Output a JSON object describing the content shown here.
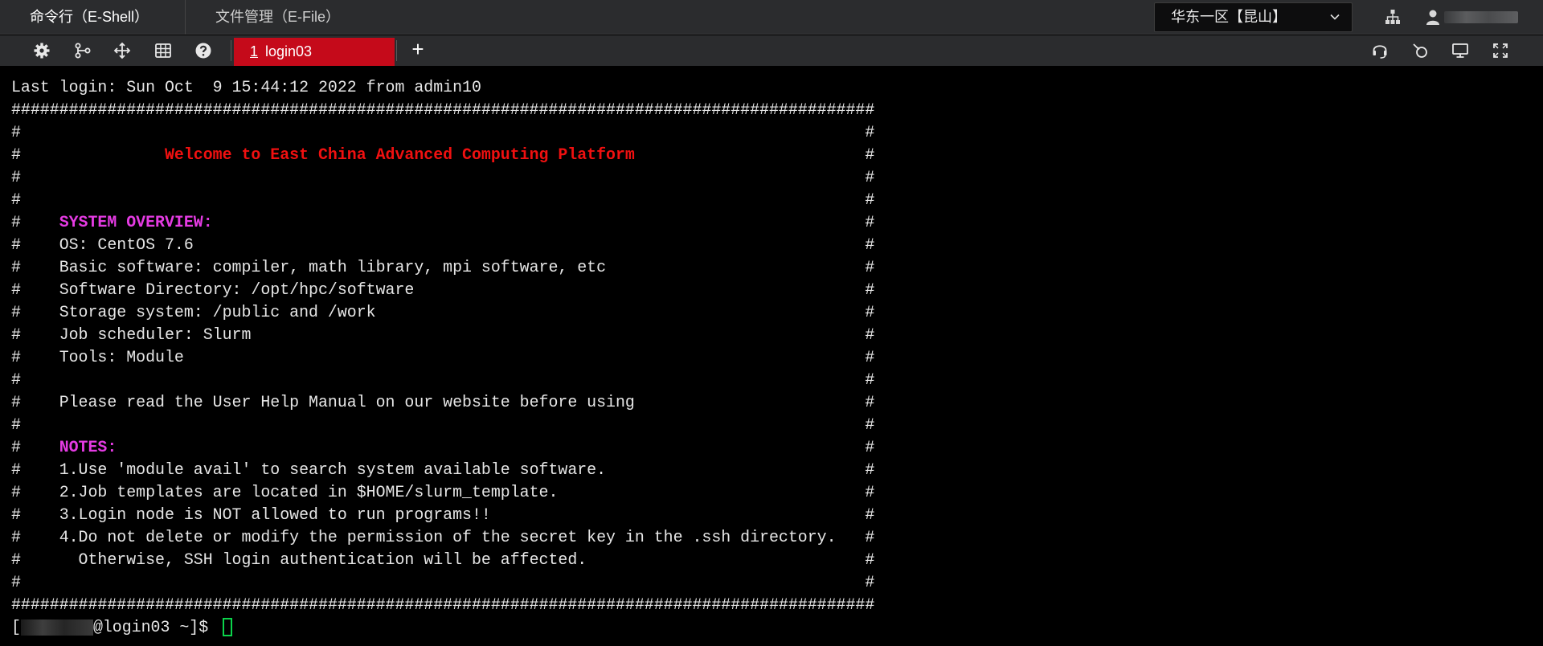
{
  "header": {
    "tabs": [
      {
        "label": "命令行（E-Shell）"
      },
      {
        "label": "文件管理（E-File）"
      }
    ],
    "region": "华东一区【昆山】"
  },
  "toolbar": {
    "session_tab": {
      "num": "1",
      "label": " login03"
    },
    "add_label": "+"
  },
  "terminal": {
    "last_login": "Last login: Sun Oct  9 15:44:12 2022 from admin10",
    "border": "##########################################################################################",
    "welcome": "Welcome to East China Advanced Computing Platform",
    "overview_heading": "SYSTEM OVERVIEW:",
    "overview_lines": [
      "OS: CentOS 7.6",
      "Basic software: compiler, math library, mpi software, etc",
      "Software Directory: /opt/hpc/software",
      "Storage system: /public and /work",
      "Job scheduler: Slurm",
      "Tools: Module"
    ],
    "help_line": "Please read the User Help Manual on our website before using",
    "notes_heading": "NOTES:",
    "notes": [
      "1.Use 'module avail' to search system available software.",
      "2.Job templates are located in $HOME/slurm_template.",
      "3.Login node is NOT allowed to run programs!!",
      "4.Do not delete or modify the permission of the secret key in the .ssh directory.",
      "  Otherwise, SSH login authentication will be affected."
    ],
    "prompt_open": "[",
    "prompt_rest": "@login03 ~]$ "
  },
  "colors": {
    "session_tab": "#c50a1a",
    "welcome_text": "#f01010",
    "heading_text": "#e53be3",
    "cursor": "#0bd44b"
  },
  "icons": {
    "header": [
      "sitemap-icon",
      "user-icon"
    ],
    "toolbar_left": [
      "gear-icon",
      "share-nodes-icon",
      "transfer-arrows-icon",
      "keyboard-icon",
      "help-icon"
    ],
    "toolbar_right": [
      "headset-icon",
      "plug-icon",
      "monitor-icon",
      "fullscreen-icon"
    ]
  }
}
